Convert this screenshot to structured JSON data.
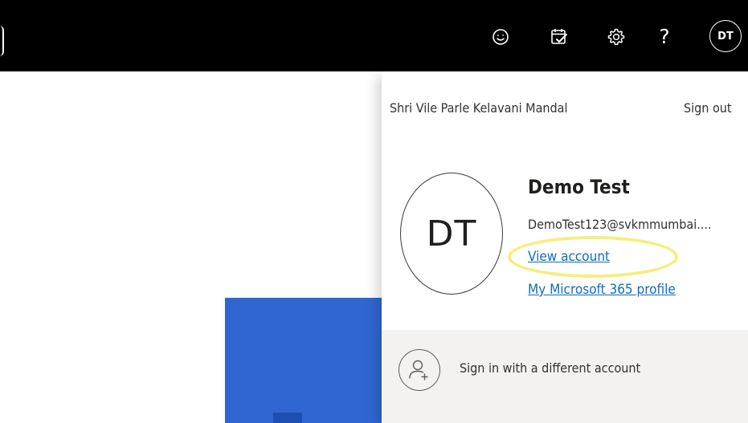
{
  "header": {
    "icons": [
      "feedback-smiley-icon",
      "my-day-calendar-icon",
      "settings-gear-icon",
      "help-icon"
    ],
    "help_glyph": "?",
    "avatar_initials": "DT"
  },
  "account_panel": {
    "organization": "Shri Vile Parle Kelavani Mandal",
    "sign_out_label": "Sign out",
    "avatar_initials": "DT",
    "user_name": "Demo Test",
    "user_email": "DemoTest123@svkmmumbai....",
    "view_account_label": "View account",
    "profile_link_label": "My Microsoft 365 profile",
    "switch_account_label": "Sign in with a different account"
  },
  "colors": {
    "header_bg": "#000000",
    "link": "#0f6cbd",
    "highlight": "#f4ee7d",
    "tile_blue": "#2f66d1",
    "footer_bg": "#f3f2f1"
  }
}
